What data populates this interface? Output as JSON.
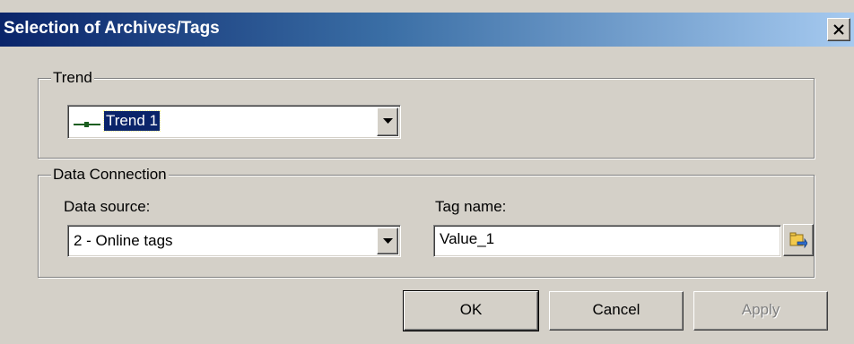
{
  "window": {
    "title": "Selection of Archives/Tags",
    "close_icon": "close-icon"
  },
  "trend_group": {
    "legend": "Trend",
    "selected": "Trend 1",
    "swatch_color": "#1b5e20"
  },
  "connection_group": {
    "legend": "Data Connection",
    "data_source_label": "Data source:",
    "data_source_value": "2 - Online tags",
    "tag_name_label": "Tag name:",
    "tag_name_value": "Value_1",
    "browse_icon": "browse-tags-icon"
  },
  "buttons": {
    "ok": "OK",
    "cancel": "Cancel",
    "apply": "Apply"
  },
  "colors": {
    "title_bar_start": "#0a246a",
    "title_bar_end": "#a6caf0",
    "dialog_face": "#d4d0c8"
  }
}
